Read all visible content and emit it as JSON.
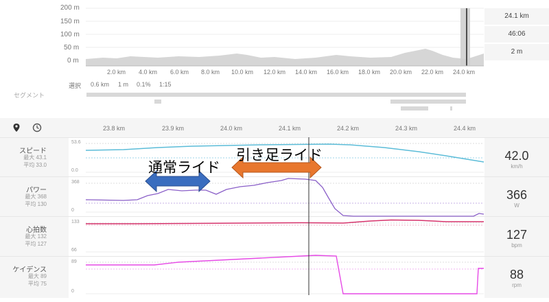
{
  "elevation": {
    "y_labels": [
      "200 m",
      "150 m",
      "100 m",
      "50 m",
      "0 m"
    ],
    "x_labels": [
      "2.0 km",
      "4.0 km",
      "6.0 km",
      "8.0 km",
      "10.0 km",
      "12.0 km",
      "14.0 km",
      "16.0 km",
      "18.0 km",
      "20.0 km",
      "22.0 km",
      "24.0 km"
    ]
  },
  "stats": {
    "distance": "24.1 km",
    "time": "46:06",
    "elevation": "2 m"
  },
  "segment": {
    "label": "セグメント",
    "select_label": "選択",
    "select_values": [
      "0.6 km",
      "1 m",
      "0.1%",
      "1:15"
    ]
  },
  "zoom_axis": {
    "labels": [
      "23.8 km",
      "23.9 km",
      "24.0 km",
      "24.1 km",
      "24.2 km",
      "24.3 km",
      "24.4 km"
    ]
  },
  "annotations": {
    "normal": "通常ライド",
    "pull": "引き足ライド"
  },
  "rows": {
    "speed": {
      "name": "スピード",
      "max": "最大 43.1",
      "avg": "平均 33.0",
      "scale_top": "53.6",
      "scale_bottom": "0.0",
      "value": "42.0",
      "unit": "km/h"
    },
    "power": {
      "name": "パワー",
      "max": "最大 368",
      "avg": "平均 130",
      "scale_top": "368",
      "scale_bottom": "0",
      "value": "366",
      "unit": "W"
    },
    "hr": {
      "name": "心拍数",
      "max": "最大 132",
      "avg": "平均 127",
      "scale_top": "133",
      "scale_bottom": "66",
      "value": "127",
      "unit": "bpm"
    },
    "cadence": {
      "name": "ケイデンス",
      "max": "最大 89",
      "avg": "平均 75",
      "scale_top": "89",
      "scale_bottom": "0",
      "value": "88",
      "unit": "rpm"
    }
  },
  "colors": {
    "speed": "#5bbcd8",
    "power": "#8a5fc8",
    "hr": "#d6336c",
    "cadence": "#e64ae6",
    "arrow_blue": "#3a6dbf",
    "arrow_orange": "#e8772e"
  }
}
